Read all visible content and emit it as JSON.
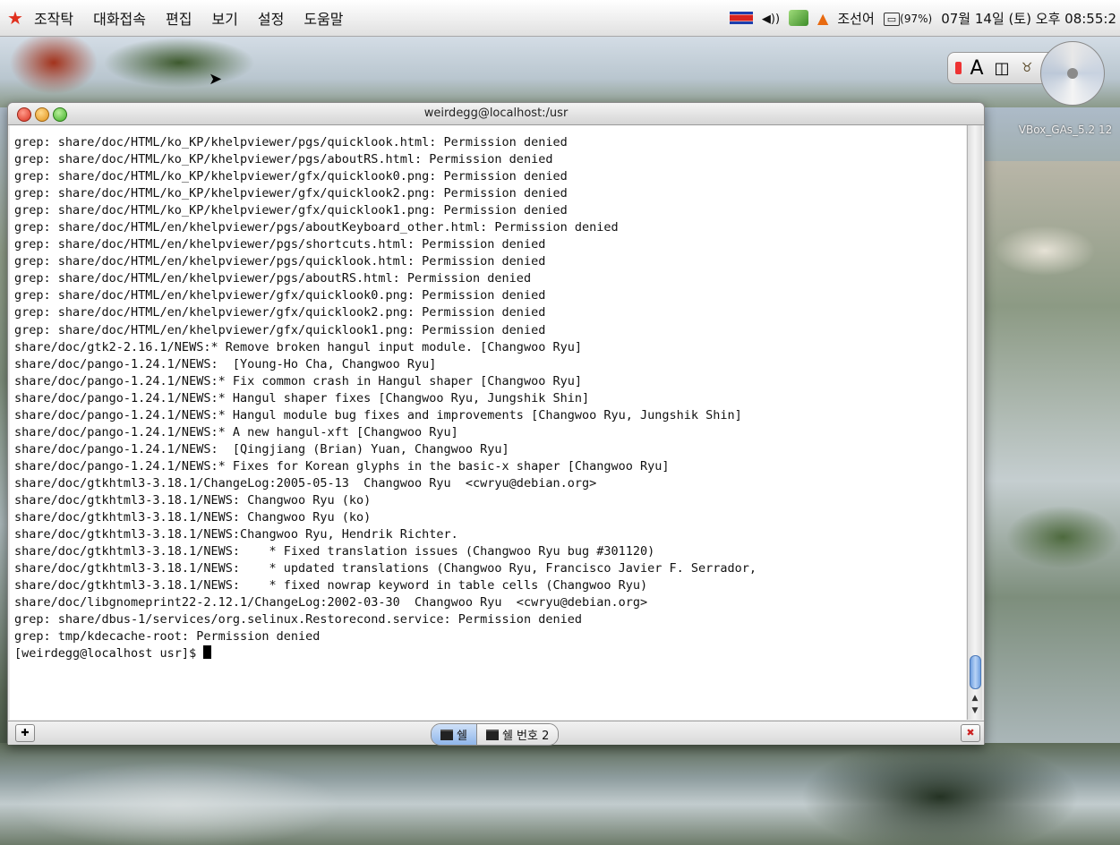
{
  "menubar": {
    "items": [
      "조작탁",
      "대화접속",
      "편집",
      "보기",
      "설정",
      "도움말"
    ],
    "ime": "조선어",
    "battery": "(97%)",
    "clock": "07월 14일 (토) 오후 08:55:2"
  },
  "desktop": {
    "cd_label": "VBox_GAs_5.2 12"
  },
  "window": {
    "title": "weirdegg@localhost:/usr"
  },
  "terminal": {
    "lines": [
      "grep: share/doc/HTML/ko_KP/khelpviewer/pgs/quicklook.html: Permission denied",
      "grep: share/doc/HTML/ko_KP/khelpviewer/pgs/aboutRS.html: Permission denied",
      "grep: share/doc/HTML/ko_KP/khelpviewer/gfx/quicklook0.png: Permission denied",
      "grep: share/doc/HTML/ko_KP/khelpviewer/gfx/quicklook2.png: Permission denied",
      "grep: share/doc/HTML/ko_KP/khelpviewer/gfx/quicklook1.png: Permission denied",
      "grep: share/doc/HTML/en/khelpviewer/pgs/aboutKeyboard_other.html: Permission denied",
      "grep: share/doc/HTML/en/khelpviewer/pgs/shortcuts.html: Permission denied",
      "grep: share/doc/HTML/en/khelpviewer/pgs/quicklook.html: Permission denied",
      "grep: share/doc/HTML/en/khelpviewer/pgs/aboutRS.html: Permission denied",
      "grep: share/doc/HTML/en/khelpviewer/gfx/quicklook0.png: Permission denied",
      "grep: share/doc/HTML/en/khelpviewer/gfx/quicklook2.png: Permission denied",
      "grep: share/doc/HTML/en/khelpviewer/gfx/quicklook1.png: Permission denied",
      "share/doc/gtk2-2.16.1/NEWS:* Remove broken hangul input module. [Changwoo Ryu]",
      "share/doc/pango-1.24.1/NEWS:  [Young-Ho Cha, Changwoo Ryu]",
      "share/doc/pango-1.24.1/NEWS:* Fix common crash in Hangul shaper [Changwoo Ryu]",
      "share/doc/pango-1.24.1/NEWS:* Hangul shaper fixes [Changwoo Ryu, Jungshik Shin]",
      "share/doc/pango-1.24.1/NEWS:* Hangul module bug fixes and improvements [Changwoo Ryu, Jungshik Shin]",
      "share/doc/pango-1.24.1/NEWS:* A new hangul-xft [Changwoo Ryu]",
      "share/doc/pango-1.24.1/NEWS:  [Qingjiang (Brian) Yuan, Changwoo Ryu]",
      "share/doc/pango-1.24.1/NEWS:* Fixes for Korean glyphs in the basic-x shaper [Changwoo Ryu]",
      "share/doc/gtkhtml3-3.18.1/ChangeLog:2005-05-13  Changwoo Ryu  <cwryu@debian.org>",
      "share/doc/gtkhtml3-3.18.1/NEWS: Changwoo Ryu (ko)",
      "share/doc/gtkhtml3-3.18.1/NEWS: Changwoo Ryu (ko)",
      "share/doc/gtkhtml3-3.18.1/NEWS:Changwoo Ryu, Hendrik Richter.",
      "share/doc/gtkhtml3-3.18.1/NEWS:    * Fixed translation issues (Changwoo Ryu bug #301120)",
      "share/doc/gtkhtml3-3.18.1/NEWS:    * updated translations (Changwoo Ryu, Francisco Javier F. Serrador,",
      "share/doc/gtkhtml3-3.18.1/NEWS:    * fixed nowrap keyword in table cells (Changwoo Ryu)",
      "share/doc/libgnomeprint22-2.12.1/ChangeLog:2002-03-30  Changwoo Ryu  <cwryu@debian.org>",
      "grep: share/dbus-1/services/org.selinux.Restorecond.service: Permission denied",
      "grep: tmp/kdecache-root: Permission denied"
    ],
    "prompt": "[weirdegg@localhost usr]$ "
  },
  "tabs": [
    {
      "label": "쉘",
      "active": true
    },
    {
      "label": "쉘 번호 2",
      "active": false
    }
  ]
}
